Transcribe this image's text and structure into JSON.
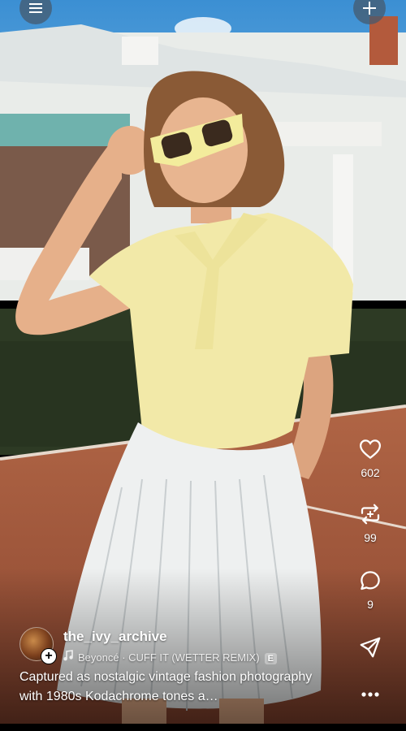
{
  "top_bar": {
    "menu_icon": "hamburger-menu-icon",
    "create_icon": "plus-icon"
  },
  "actions": {
    "like": {
      "icon": "heart-icon",
      "count": "602"
    },
    "repost": {
      "icon": "repost-icon",
      "count": "99"
    },
    "comment": {
      "icon": "comment-icon",
      "count": "9"
    },
    "share": {
      "icon": "send-icon"
    },
    "more": {
      "icon": "more-icon"
    }
  },
  "post": {
    "username": "the_ivy_archive",
    "music_icon": "music-note-icon",
    "track": "Beyoncé · CUFF IT (WETTER REMIX)",
    "explicit_badge": "E",
    "caption": "Captured as nostalgic vintage fashion photography with 1980s Kodachrome tones a…",
    "follow_plus": "+"
  },
  "colors": {
    "sky": "#3d8fd0",
    "clay_court": "#a0543a",
    "shirt": "#f2e9a8",
    "skirt": "#eef0f0",
    "hedge": "#2d3a24",
    "overlay_button": "#465a6e"
  }
}
